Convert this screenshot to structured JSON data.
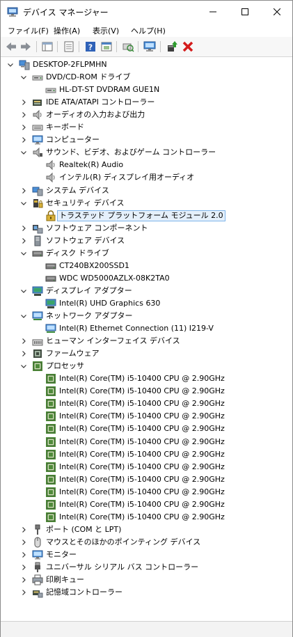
{
  "window": {
    "title": "デバイス マネージャー"
  },
  "menu": [
    {
      "label": "ファイル(F)"
    },
    {
      "label": "操作(A)"
    },
    {
      "label": "表示(V)"
    },
    {
      "label": "ヘルプ(H)"
    }
  ],
  "toolbar": {
    "buttons": [
      "back-icon",
      "forward-icon",
      "properties-pane-icon",
      "help-icon",
      "show-hidden-icon",
      "scan-hardware-icon",
      "monitor-icon",
      "update-driver-icon",
      "uninstall-icon"
    ]
  },
  "tree": {
    "root": "DESKTOP-2FLPMHN",
    "dvd": {
      "label": "DVD/CD-ROM ドライブ",
      "children": [
        "HL-DT-ST DVDRAM GUE1N"
      ]
    },
    "ide": "IDE ATA/ATAPI コントローラー",
    "audio_io": "オーディオの入力および出力",
    "keyboard": "キーボード",
    "computer": "コンピューター",
    "sound": {
      "label": "サウンド、ビデオ、およびゲーム コントローラー",
      "children": [
        "Realtek(R) Audio",
        "インテル(R) ディスプレイ用オーディオ"
      ]
    },
    "system": "システム デバイス",
    "security": {
      "label": "セキュリティ デバイス",
      "children": [
        "トラステッド プラットフォーム モジュール 2.0"
      ]
    },
    "sw_component": "ソフトウェア コンポーネント",
    "sw_device": "ソフトウェア デバイス",
    "disk": {
      "label": "ディスク ドライブ",
      "children": [
        "CT240BX200SSD1",
        "WDC WD5000AZLX-08K2TA0"
      ]
    },
    "display": {
      "label": "ディスプレイ アダプター",
      "children": [
        "Intel(R) UHD Graphics 630"
      ]
    },
    "network": {
      "label": "ネットワーク アダプター",
      "children": [
        "Intel(R) Ethernet Connection (11) I219-V"
      ]
    },
    "hid": "ヒューマン インターフェイス デバイス",
    "firmware": "ファームウェア",
    "processor": {
      "label": "プロセッサ",
      "cpu": "Intel(R) Core(TM) i5-10400 CPU @ 2.90GHz",
      "count": 12
    },
    "ports": "ポート (COM と LPT)",
    "mouse": "マウスとそのほかのポインティング デバイス",
    "monitor": "モニター",
    "usb": "ユニバーサル シリアル バス コントローラー",
    "print": "印刷キュー",
    "storage": "記憶域コントローラー"
  }
}
